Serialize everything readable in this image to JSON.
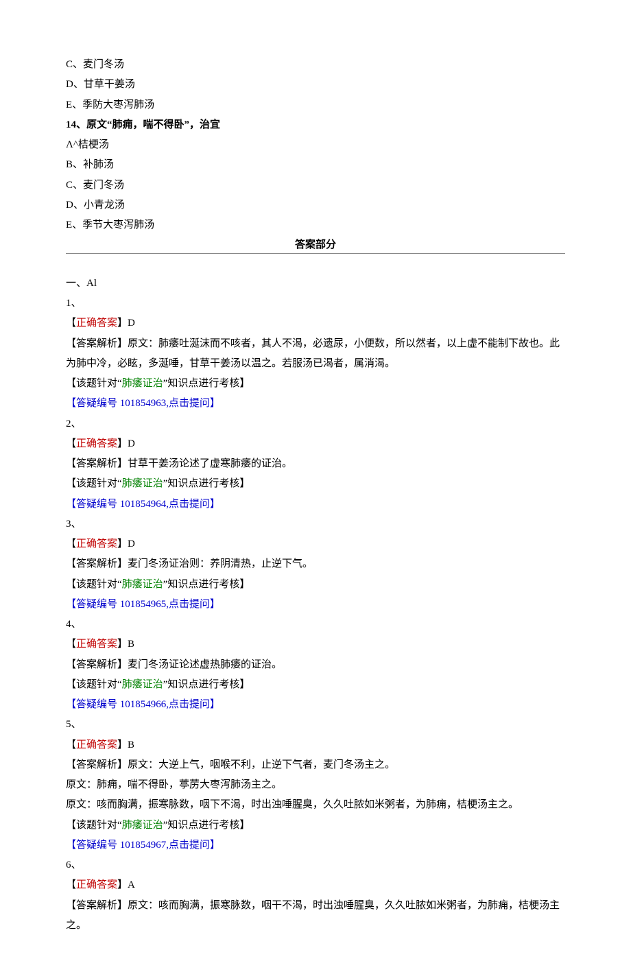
{
  "q13": {
    "optC": "C、麦门冬汤",
    "optD": "D、甘草干姜汤",
    "optE": "E、季防大枣泻肺汤"
  },
  "q14": {
    "stem": "14、原文“肺痈，喘不得卧”，治宜",
    "optA": "Λ^桔梗汤",
    "optB": "B、补肺汤",
    "optC": "C、麦门冬汤",
    "optD": "D、小青龙汤",
    "optE": "E、季节大枣泻肺汤"
  },
  "answersHeading": "答案部分",
  "sectionLabel": "一、Al",
  "labels": {
    "correctPrefix": "【",
    "correctText": "正确答案",
    "correctSuffix": "】",
    "explainPrefix": "【答案解析】",
    "topicPrefix1": "【该题针对“",
    "topicTerm": "肺痿证治",
    "topicPrefix2": "”知识点进行考核】",
    "faqPrefix": "【",
    "faqLabel": "答疑编号",
    "faqClick": "点击提问",
    "faqSuffix": "】"
  },
  "answers": [
    {
      "num": "1、",
      "correct": "D",
      "explain": "原文：肺痿吐涎沫而不咳者，其人不渴，必遗尿，小便数，所以然者，以上虚不能制下故也。此为肺中冷，必眩，多涎唾，甘草干姜汤以温之。若服汤已渴者，属消渴。",
      "faqId": "101854963"
    },
    {
      "num": "2、",
      "correct": "D",
      "explain": "甘草干姜汤论述了虚寒肺痿的证治。",
      "faqId": "101854964"
    },
    {
      "num": "3、",
      "correct": "D",
      "explain": "麦门冬汤证治则：养阴清热，止逆下气。",
      "faqId": "101854965"
    },
    {
      "num": "4、",
      "correct": "B",
      "explain": "麦门冬汤证论述虚热肺痿的证治。",
      "faqId": "101854966"
    },
    {
      "num": "5、",
      "correct": "B",
      "explain": "原文：大逆上气，咽喉不利，止逆下气者，麦门冬汤主之。",
      "extraLines": [
        "原文：肺痈，喘不得卧，葶苈大枣泻肺汤主之。",
        "原文：咳而胸满，振寒脉数，咽下不渴，时出浊唾腥臭，久久吐脓如米粥者，为肺痈，桔梗汤主之。"
      ],
      "faqId": "101854967"
    },
    {
      "num": "6、",
      "correct": "A",
      "explain": "原文：咳而胸满，振寒脉数，咽干不渴，时出浊唾腥臭，久久吐脓如米粥者，为肺痈，桔梗汤主之。",
      "noFooter": true
    }
  ]
}
